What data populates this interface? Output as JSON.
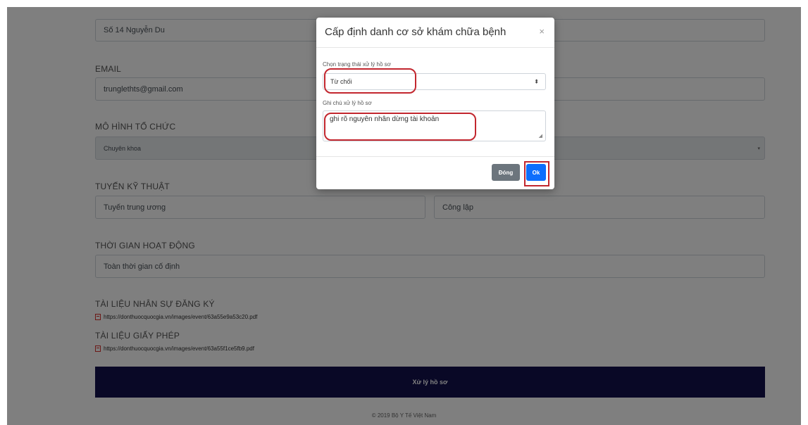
{
  "form": {
    "address_value": "Số 14 Nguyễn Du",
    "email_label": "EMAIL",
    "email_value": "trunglethts@gmail.com",
    "org_model_label": "MÔ HÌNH TỔ CHỨC",
    "org_model_value": "Chuyên khoa",
    "tech_level_label": "TUYẾN KỸ THUẬT",
    "tech_level_value": "Tuyến trung ương",
    "ownership_value": "Công lập",
    "operating_time_label": "THỜI GIAN HOẠT ĐỘNG",
    "operating_time_value": "Toàn thời gian cố định",
    "staff_docs_label": "TÀI LIỆU NHÂN SỰ ĐĂNG KÝ",
    "staff_docs_link": "https://donthuocquocgia.vn/images/event/63a55e9a53c20.pdf",
    "license_docs_label": "TÀI LIỆU GIẤY PHÉP",
    "license_docs_link": "https://donthuocquocgia.vn/images/event/63a55f1ce5fb9.pdf",
    "submit_label": "Xử lý hồ sơ"
  },
  "footer": {
    "text": "© 2019 Bộ Y Tế Việt Nam"
  },
  "modal": {
    "title": "Cấp định danh cơ sở khám chữa bệnh",
    "close_symbol": "×",
    "status_label": "Chọn trạng thái xử lý hồ sơ",
    "status_value": "Từ chối",
    "note_label": "Ghi chú xử lý hồ sơ",
    "note_value": "ghi rõ nguyên nhân dừng tài khoản",
    "close_button": "Đóng",
    "ok_button": "Ok"
  },
  "colors": {
    "submit_bar": "#12104d",
    "ok_button": "#0d6efd",
    "close_button": "#6c757d",
    "highlight": "#c2262e",
    "pdf_icon": "#d9302c"
  },
  "icons": [
    "pdf-icon",
    "close-icon",
    "select-caret-icon",
    "resize-grip-icon"
  ]
}
